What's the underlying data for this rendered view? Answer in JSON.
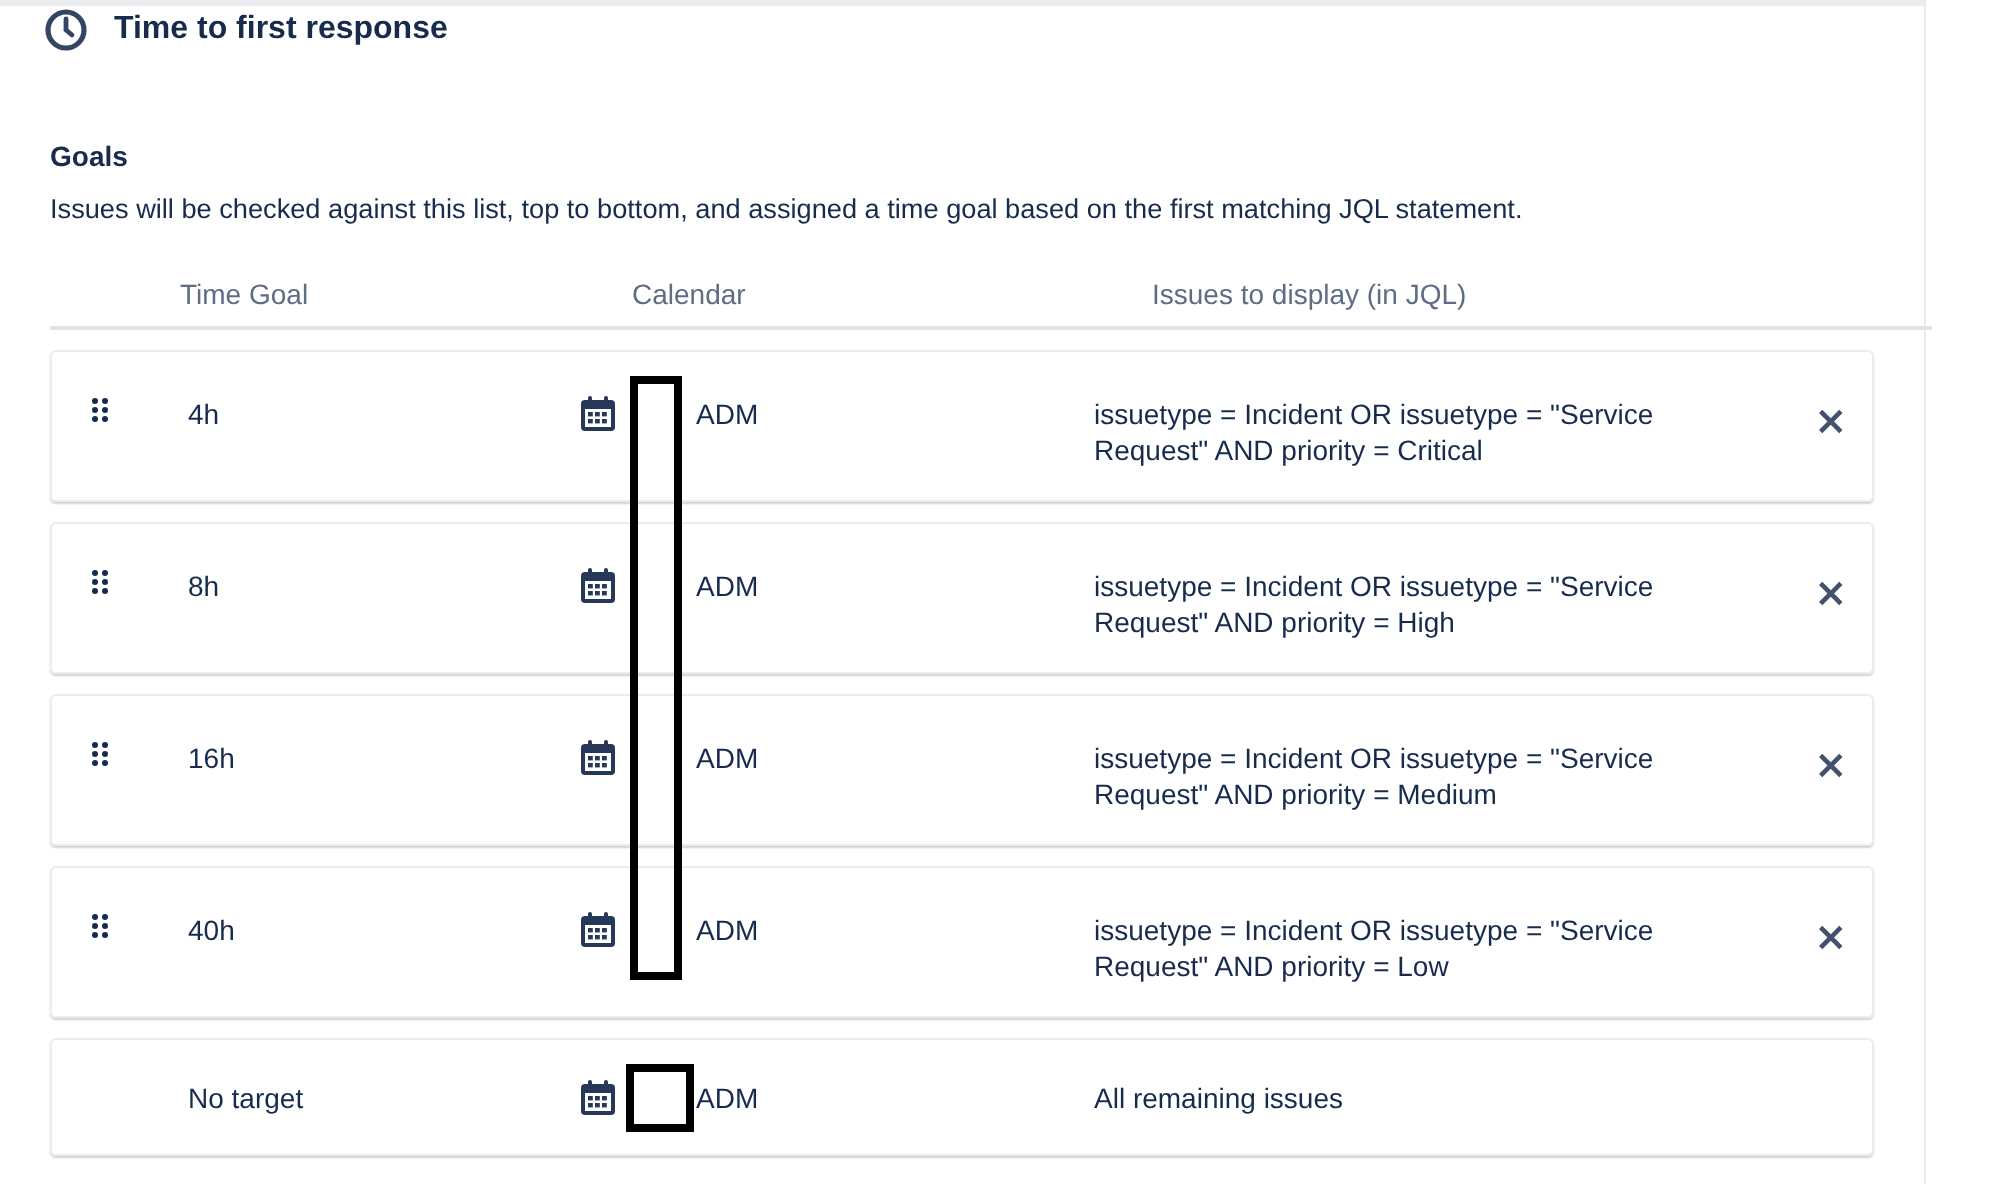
{
  "section": {
    "title": "Time to first response"
  },
  "goals": {
    "heading": "Goals",
    "description": "Issues will be checked against this list, top to bottom, and assigned a time goal based on the first matching JQL statement."
  },
  "table": {
    "columns": [
      "Time Goal",
      "Calendar",
      "Issues to display (in JQL)"
    ],
    "rows": [
      {
        "kind": "goal",
        "time_goal": "4h",
        "calendar": "ADM",
        "jql": "issuetype = Incident OR issuetype = \"Service Request\" AND priority = Critical",
        "remove": "×"
      },
      {
        "kind": "goal",
        "time_goal": "8h",
        "calendar": "ADM",
        "jql": "issuetype = Incident OR issuetype = \"Service Request\" AND priority = High",
        "remove": "×"
      },
      {
        "kind": "goal",
        "time_goal": "16h",
        "calendar": "ADM",
        "jql": "issuetype = Incident OR issuetype = \"Service Request\" AND priority = Medium",
        "remove": "×"
      },
      {
        "kind": "goal",
        "time_goal": "40h",
        "calendar": "ADM",
        "jql": "issuetype = Incident OR issuetype = \"Service Request\" AND priority = Low",
        "remove": "×"
      },
      {
        "kind": "fallback",
        "time_goal": "No target",
        "calendar": "ADM",
        "jql": "All remaining issues"
      }
    ]
  }
}
